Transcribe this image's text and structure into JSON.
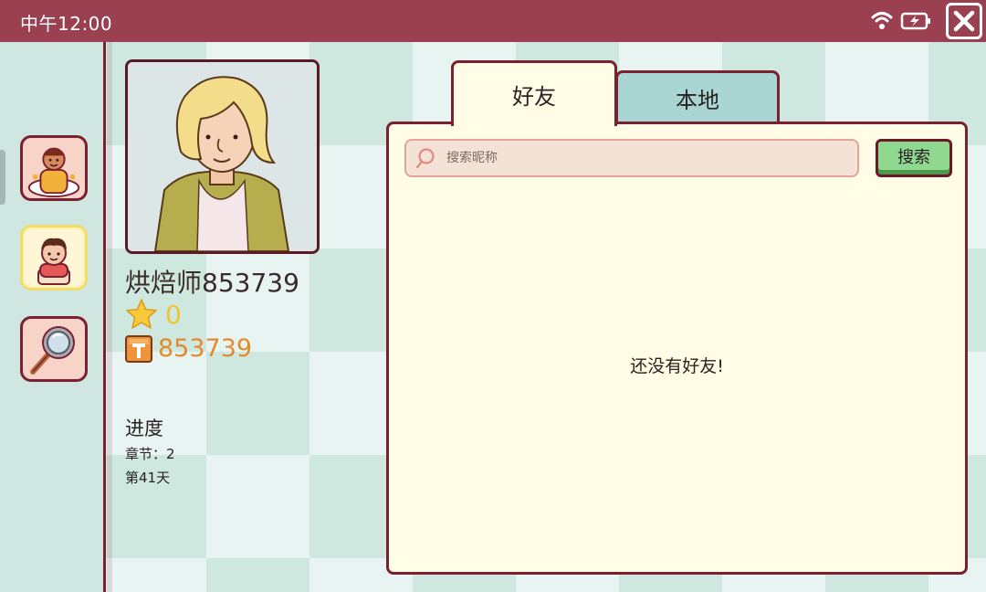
{
  "status_bar": {
    "time": "中午12:00",
    "icons": [
      "wifi-icon",
      "battery-charging-icon",
      "close-icon"
    ]
  },
  "sidebar": {
    "items": [
      {
        "name": "chef-profile",
        "icon": "chef-avatar-icon"
      },
      {
        "name": "friends",
        "icon": "friends-avatar-icon",
        "selected": true
      },
      {
        "name": "search",
        "icon": "magnifier-icon"
      }
    ]
  },
  "profile": {
    "name": "烘焙师853739",
    "stars": "0",
    "id": "853739",
    "progress": {
      "title": "进度",
      "chapter": "章节：2",
      "day": "第41天"
    }
  },
  "tabs": [
    {
      "label": "好友",
      "active": true
    },
    {
      "label": "本地",
      "active": false
    }
  ],
  "search": {
    "placeholder": "搜索昵称",
    "value": "",
    "button_label": "搜索"
  },
  "friends_list": {
    "empty_message": "还没有好友!"
  },
  "colors": {
    "topbar": "#9b4050",
    "border": "#7a2030",
    "panel": "#fffde6",
    "active_tab": "#fffde6",
    "inactive_tab": "#a9d6d2",
    "search_button": "#8fd88f",
    "star": "#f2c230",
    "id_text": "#e48a2c"
  }
}
